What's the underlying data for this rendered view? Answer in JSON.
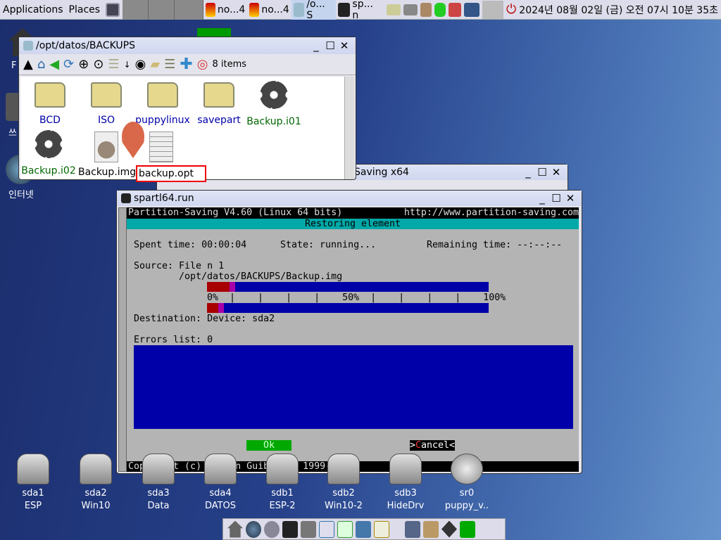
{
  "panel": {
    "applications": "Applications",
    "places": "Places",
    "tasks": [
      {
        "label": "no...4",
        "icon": "puppy-icon"
      },
      {
        "label": "no...4",
        "icon": "puppy-icon"
      },
      {
        "label": "/o... S",
        "icon": "file-manager-icon"
      },
      {
        "label": "sp... n",
        "icon": "terminal-icon"
      }
    ],
    "clock": "2024년 08월 02일 (금) 오전 07시 10분 35초"
  },
  "desktop": {
    "left_icons": [
      "F",
      "쓰",
      "인터넷"
    ],
    "drives": [
      {
        "dev": "sda1",
        "label": "ESP"
      },
      {
        "dev": "sda2",
        "label": "Win10"
      },
      {
        "dev": "sda3",
        "label": "Data"
      },
      {
        "dev": "sda4",
        "label": "DATOS"
      },
      {
        "dev": "sdb1",
        "label": "ESP-2"
      },
      {
        "dev": "sdb2",
        "label": "Win10-2"
      },
      {
        "dev": "sdb3",
        "label": "HideDrv"
      },
      {
        "dev": "sr0",
        "label": "puppy_v.."
      }
    ]
  },
  "filemanager": {
    "title": "/opt/datos/BACKUPS",
    "item_count": "8 items",
    "items": [
      {
        "name": "BCD",
        "type": "folder"
      },
      {
        "name": "ISO",
        "type": "folder"
      },
      {
        "name": "puppylinux",
        "type": "folder"
      },
      {
        "name": "savepart",
        "type": "folder"
      },
      {
        "name": "Backup.i01",
        "type": "exec"
      },
      {
        "name": "Backup.i02",
        "type": "exec"
      },
      {
        "name": "Backup.img",
        "type": "image"
      },
      {
        "name": "backup.opt",
        "type": "text",
        "highlighted": true
      }
    ]
  },
  "bgwindow": {
    "title": "Saving x64"
  },
  "terminal": {
    "title": "spartl64.run",
    "header_left": "Partition-Saving V4.60 (Linux 64 bits)",
    "header_right": "http://www.partition-saving.com",
    "subtitle": "Restoring element",
    "spent": "Spent time: 00:00:04",
    "state": "State: running...",
    "remaining": "Remaining time: --:--:--",
    "source": "Source: File n 1",
    "source_path": "/opt/datos/BACKUPS/Backup.img",
    "scale": "0%  |    |    |    |    50%  |    |    |    |    100%",
    "progress1": {
      "done_percent": 8,
      "partial_percent": 10
    },
    "progress2": {
      "done_percent": 4,
      "partial_percent": 6
    },
    "destination": "Destination: Device: sda2",
    "errors": "Errors list: 0",
    "ok": "Ok",
    "cancel_prefix": ">",
    "cancel_hot": "C",
    "cancel_rest": "ancel<",
    "copyright": "Copyright (c) Damien Guibouret 1999-2019"
  },
  "colors": {
    "term_bg": "#b4b4b4",
    "term_blue": "#0000a8",
    "term_cyan": "#00a8a8",
    "progress_red": "#a80000",
    "progress_magenta": "#a800a8",
    "ok_green": "#00a800"
  }
}
